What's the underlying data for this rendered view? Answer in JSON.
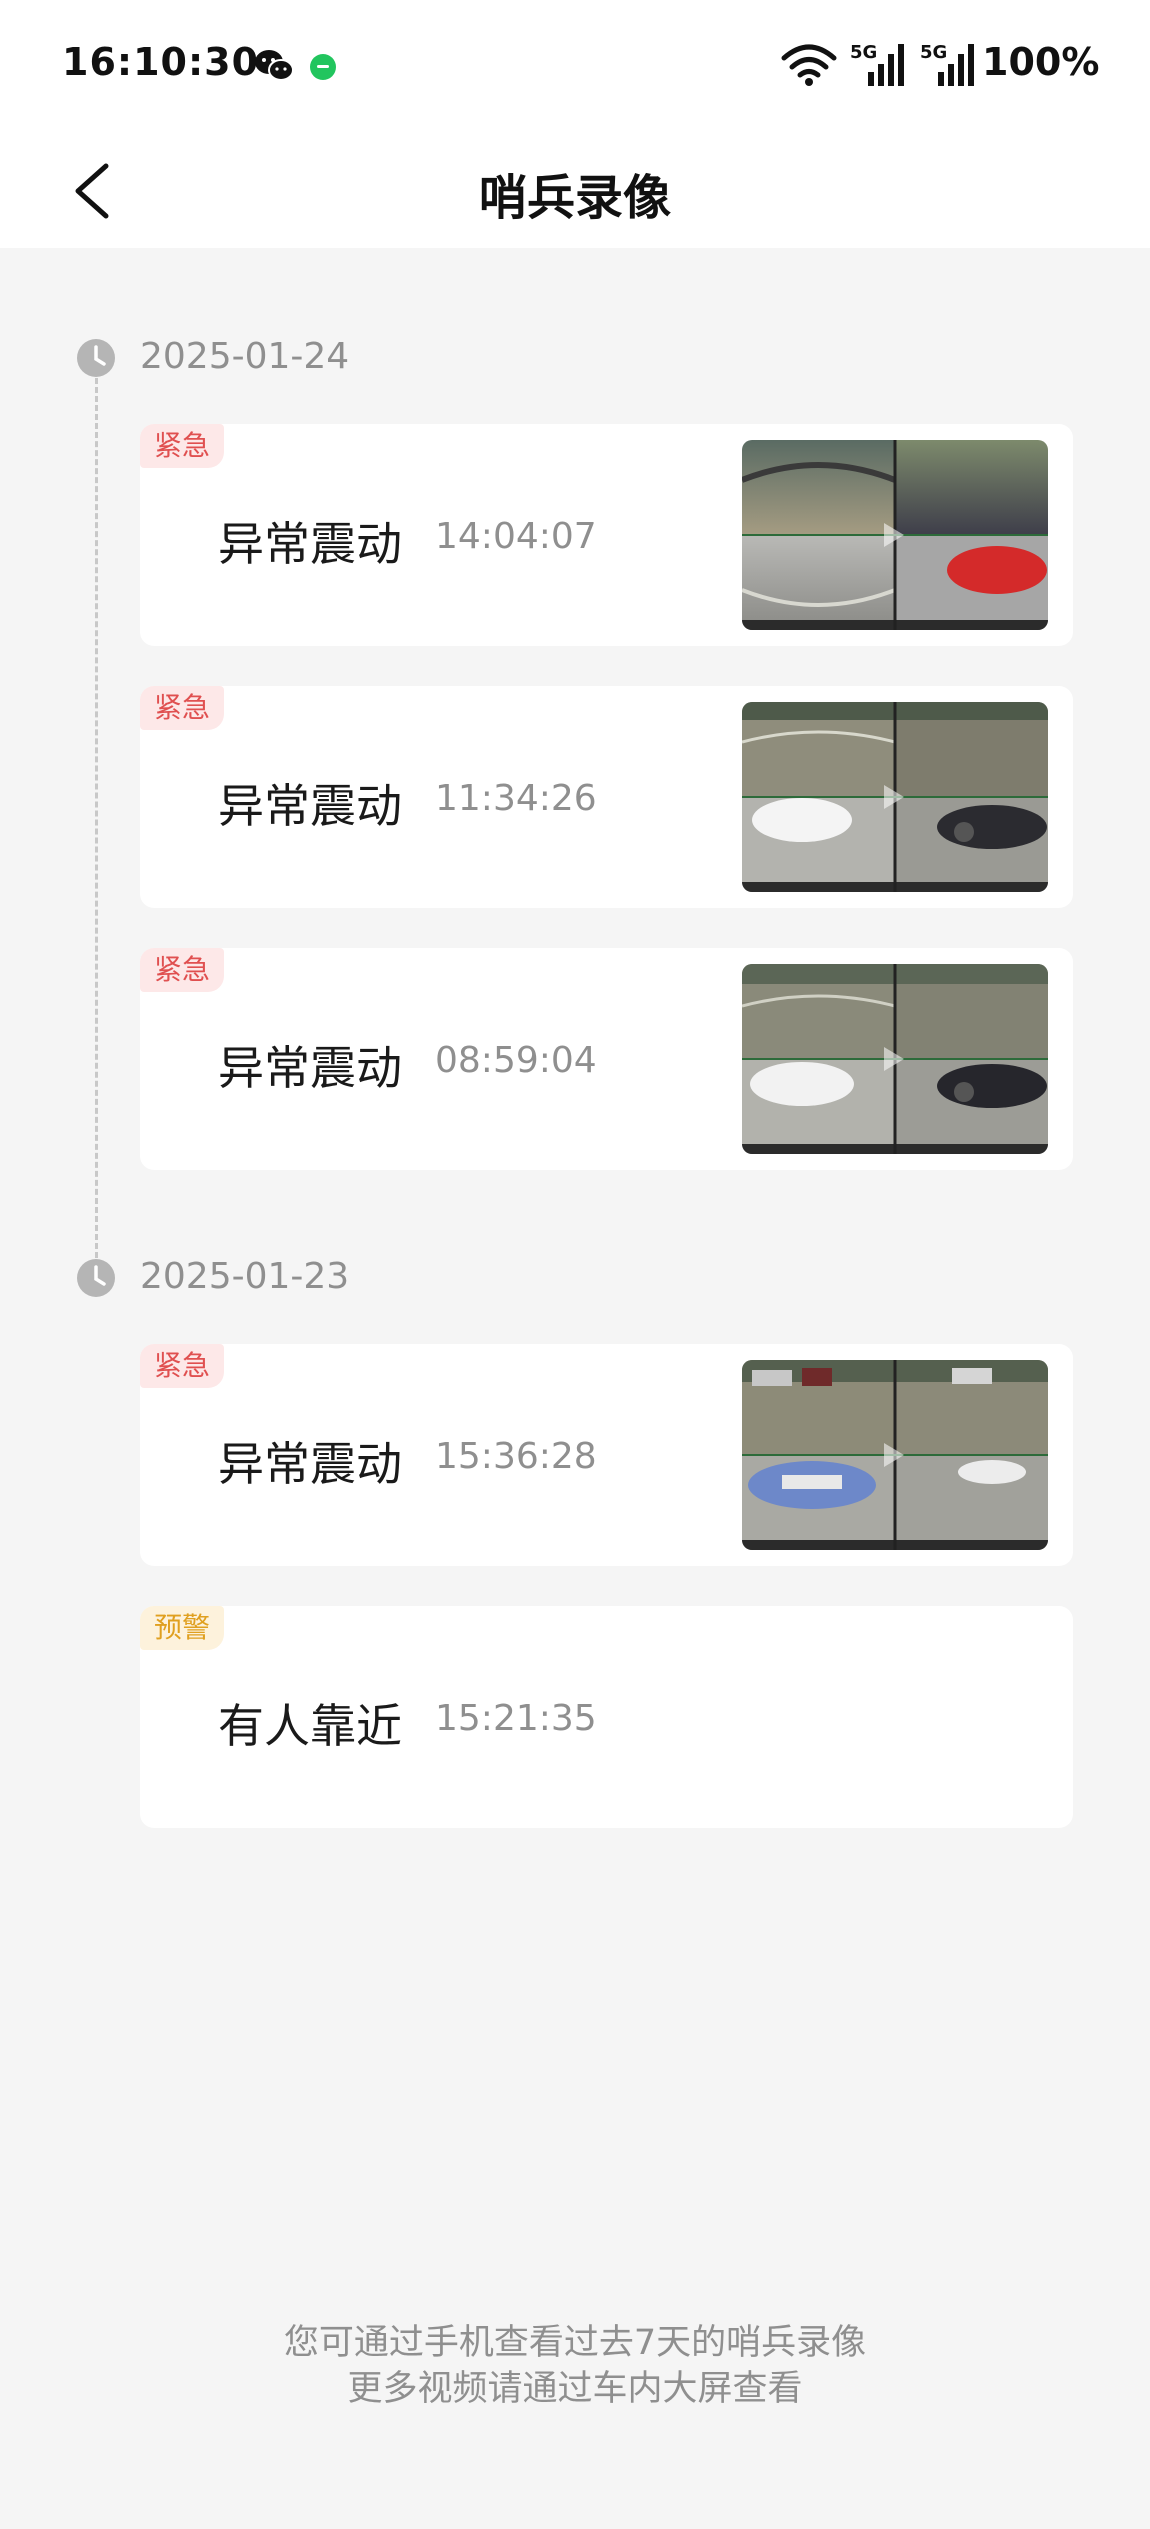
{
  "status_bar": {
    "time": "16:10:30",
    "battery": "100%",
    "network_label": "5G",
    "icons": [
      "wechat-icon",
      "app-notification-icon",
      "wifi-icon",
      "signal-5g-icon",
      "signal-5g-icon"
    ]
  },
  "header": {
    "title": "哨兵录像",
    "back_icon": "chevron-left-icon"
  },
  "groups": [
    {
      "date": "2025-01-24",
      "events": [
        {
          "tag": "紧急",
          "tag_type": "urgent",
          "name": "异常震动",
          "time": "14:04:07",
          "has_thumbnail": true
        },
        {
          "tag": "紧急",
          "tag_type": "urgent",
          "name": "异常震动",
          "time": "11:34:26",
          "has_thumbnail": true
        },
        {
          "tag": "紧急",
          "tag_type": "urgent",
          "name": "异常震动",
          "time": "08:59:04",
          "has_thumbnail": true
        }
      ]
    },
    {
      "date": "2025-01-23",
      "events": [
        {
          "tag": "紧急",
          "tag_type": "urgent",
          "name": "异常震动",
          "time": "15:36:28",
          "has_thumbnail": true
        },
        {
          "tag": "预警",
          "tag_type": "warning",
          "name": "有人靠近",
          "time": "15:21:35",
          "has_thumbnail": false
        }
      ]
    }
  ],
  "footer": {
    "line1": "您可通过手机查看过去7天的哨兵录像",
    "line2": "更多视频请通过车内大屏查看"
  },
  "colors": {
    "urgent_text": "#e05050",
    "urgent_bg": "#fde8e8",
    "warning_text": "#e0a020",
    "warning_bg": "#fdf2dc",
    "page_bg": "#f5f5f5"
  }
}
